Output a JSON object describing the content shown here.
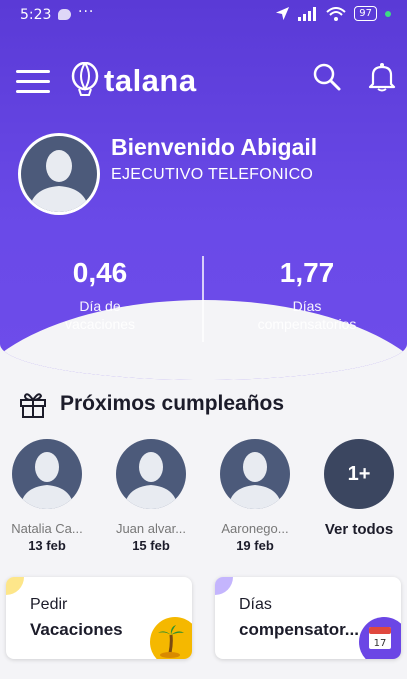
{
  "status_bar": {
    "time": "5:23",
    "dots": "···",
    "battery": "97"
  },
  "header": {
    "logo_text": "talana"
  },
  "profile": {
    "welcome": "Bienvenido Abigail",
    "role": "EJECUTIVO TELEFONICO"
  },
  "stats": [
    {
      "value": "0,46",
      "label_line1": "Día de",
      "label_line2": "vacaciones"
    },
    {
      "value": "1,77",
      "label_line1": "Días",
      "label_line2": "compensatorios"
    }
  ],
  "birthdays": {
    "title": "Próximos cumpleaños",
    "people": [
      {
        "name": "Natalia Ca...",
        "date": "13 feb"
      },
      {
        "name": "Juan alvar...",
        "date": "15 feb"
      },
      {
        "name": "Aaronego...",
        "date": "19 feb"
      }
    ],
    "more_count": "1+",
    "see_all": "Ver todos"
  },
  "cards": [
    {
      "line1": "Pedir",
      "line2": "Vacaciones",
      "accent": "#fde68a",
      "badge_color": "#f5b800",
      "icon": "palm-tree-icon"
    },
    {
      "line1": "Días",
      "line2": "compensator...",
      "accent": "#c4b5fd",
      "badge_color": "#6b46e5",
      "icon": "calendar-icon",
      "calendar_day": "17"
    }
  ],
  "colors": {
    "brand": "#6a4ae8",
    "avatar": "#4c5a7a",
    "text": "#1c1c2a"
  }
}
